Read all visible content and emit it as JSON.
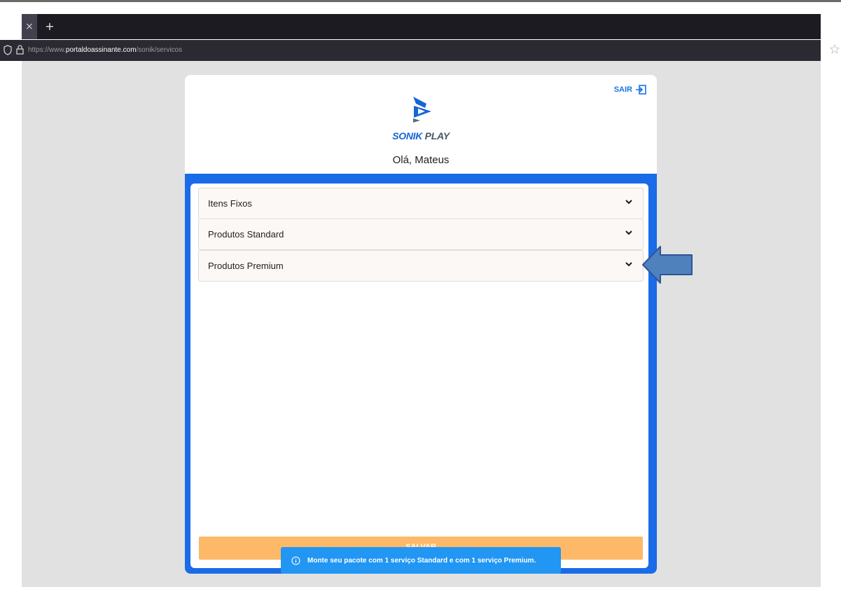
{
  "browser": {
    "tab_close_glyph": "×",
    "new_tab_glyph": "+",
    "url": {
      "scheme": "https://www.",
      "host": "portaldoassinante.com",
      "path": "/sonik/servicos"
    },
    "icons": [
      "shield-icon",
      "lock-icon",
      "bookmark-star-icon"
    ]
  },
  "header": {
    "logout_label": "SAIR",
    "logout_icon": "logout-icon",
    "brand_part1": "SONIK",
    "brand_part2": " PLAY",
    "greeting": "Olá, Mateus"
  },
  "accordion": {
    "items": [
      {
        "label": "Itens Fixos"
      },
      {
        "label": "Produtos Standard"
      },
      {
        "label": "Produtos Premium"
      }
    ]
  },
  "actions": {
    "save_label": "SALVAR"
  },
  "toast": {
    "icon": "info-icon",
    "message": "Monte seu pacote com 1 serviço Standard e com 1 serviço Premium."
  },
  "colors": {
    "primary_blue": "#1a6be8",
    "save_button": "#fdb968",
    "toast": "#2196f3",
    "annotation_arrow": "#4f81bd"
  }
}
